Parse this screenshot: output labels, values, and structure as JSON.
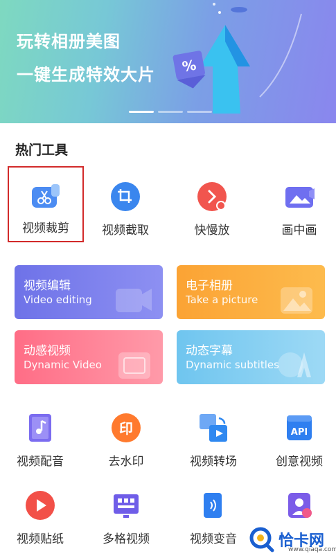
{
  "banner": {
    "line1": "玩转相册美图",
    "line2": "一键生成特效大片",
    "percent_symbol": "%"
  },
  "section_title": "热门工具",
  "top_tools": [
    {
      "label": "视频裁剪",
      "icon": "scissors-icon",
      "highlighted": true
    },
    {
      "label": "视频截取",
      "icon": "crop-icon"
    },
    {
      "label": "快慢放",
      "icon": "speed-icon"
    },
    {
      "label": "画中画",
      "icon": "picture-in-picture-icon"
    }
  ],
  "cards": [
    {
      "title": "视频编辑",
      "subtitle": "Video editing",
      "color_from": "#6e72e8",
      "color_to": "#8d90f2",
      "icon": "camera-icon"
    },
    {
      "title": "电子相册",
      "subtitle": "Take a picture",
      "color_from": "#fba334",
      "color_to": "#fdbb4d",
      "icon": "image-icon"
    },
    {
      "title": "动感视频",
      "subtitle": "Dynamic Video",
      "color_from": "#ff6d86",
      "color_to": "#ff9aa9",
      "icon": "video-frame-icon"
    },
    {
      "title": "动态字幕",
      "subtitle": "Dynamic subtitles",
      "color_from": "#6fc5ef",
      "color_to": "#9dd9f5",
      "icon": "font-a-icon"
    }
  ],
  "bottom_tools_row1": [
    {
      "label": "视频配音",
      "icon": "music-note-icon"
    },
    {
      "label": "去水印",
      "icon": "stamp-icon"
    },
    {
      "label": "视频转场",
      "icon": "transition-icon"
    },
    {
      "label": "创意视频",
      "icon": "api-icon",
      "icon_text": "API"
    }
  ],
  "bottom_tools_row2": [
    {
      "label": "视频贴纸",
      "icon": "play-sticker-icon"
    },
    {
      "label": "多格视频",
      "icon": "grid-video-icon"
    },
    {
      "label": "视频变音",
      "icon": "voice-change-icon"
    },
    {
      "label": "",
      "icon": "face-icon"
    }
  ],
  "stamp_char": "印",
  "watermark": {
    "text": "恰卡网",
    "url": "www.qiaqa.com"
  },
  "colors": {
    "highlight_border": "#d22a2a",
    "title_text": "#222222"
  }
}
